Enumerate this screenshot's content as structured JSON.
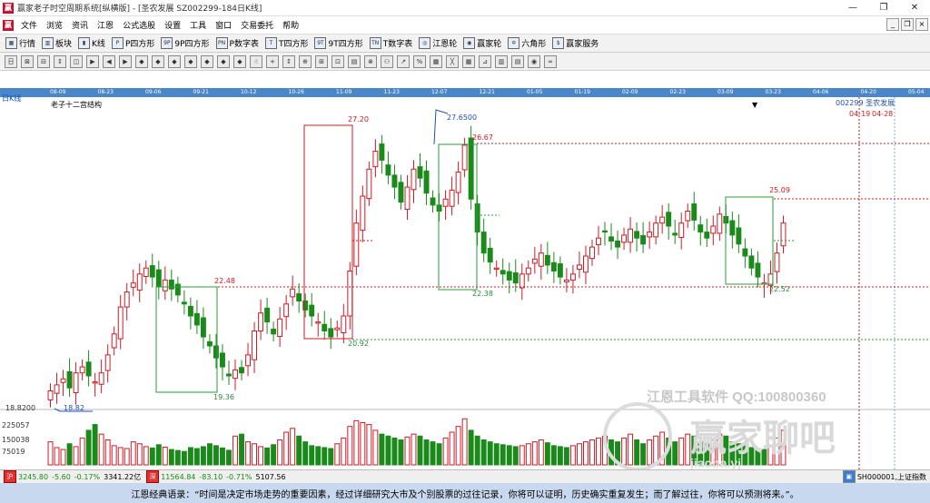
{
  "window": {
    "title": "赢家老子时空周期系统[纵横版] - [圣农发展  SZ002299-184日K线]",
    "app_icon": "赢"
  },
  "menu": [
    "文件",
    "浏览",
    "资讯",
    "江恩",
    "公式选股",
    "设置",
    "工具",
    "窗口",
    "交易委托",
    "帮助"
  ],
  "toolbar1": [
    "行情",
    "板块",
    "K线",
    "P四方形",
    "9P四方形",
    "P数字表",
    "T四方形",
    "9T四方形",
    "T数字表",
    "江恩轮",
    "赢家轮",
    "六角形",
    "赢家服务"
  ],
  "toolbar2_icons": [
    "日",
    "⊠",
    "⊟",
    "↕",
    "◫",
    "▶",
    "◀",
    "▶",
    "◆",
    "◆",
    "◆",
    "◆",
    "◆",
    "◆",
    "◆",
    "☝",
    "+",
    "↕",
    "⊕",
    "⊞",
    "⊡",
    "▤",
    "⊗",
    "⚇",
    "↗",
    "%",
    "▦",
    "╳",
    "▦",
    "⊿",
    "▥",
    "▤",
    "◉",
    "∞"
  ],
  "date_ticks": [
    "08-09",
    "08-23",
    "09-06",
    "09-21",
    "10-12",
    "10-26",
    "11-09",
    "11-23",
    "12-07",
    "12-21",
    "01-05",
    "01-19",
    "02-09",
    "02-23",
    "03-09",
    "03-23",
    "04-06",
    "04-20",
    "05-04"
  ],
  "chart": {
    "period_label": "日K线",
    "structure_label": "老子十二宫结构",
    "stock_label": "002299 圣农发展",
    "date_marks": [
      "04-19",
      "04-28"
    ],
    "price_labels": {
      "p1": "18.8200",
      "p1b": "18.82",
      "p2": "19.36",
      "p3": "22.48",
      "p4": "20.92",
      "p5": "27.20",
      "p6": "27.6500",
      "p7": "26.67",
      "p8": "22.38",
      "p9": "25.09",
      "p10": "22.52"
    },
    "vol_ticks": [
      "225057",
      "150038",
      "75019"
    ],
    "watermark1": "江恩工具软件  QQ:100800360",
    "watermark2": "赢家聊吧",
    "watermark3": "jiaoba.yj"
  },
  "chart_data": {
    "type": "candlestick",
    "title": "",
    "xlabel": "",
    "ylabel": "",
    "ylim": [
      18.5,
      28.5
    ],
    "series": [
      {
        "name": "",
        "values": [
          19.0,
          19.2,
          19.4,
          19.1,
          19.6,
          19.8,
          19.5,
          19.3,
          19.6,
          20.2,
          20.9,
          21.8,
          22.3,
          22.6,
          22.9,
          23.1,
          22.8,
          22.5,
          22.7,
          22.4,
          22.2,
          21.9,
          21.5,
          21.2,
          20.8,
          20.5,
          20.1,
          19.8,
          19.5,
          19.7,
          19.6,
          20.2,
          21.0,
          21.6,
          21.3,
          20.9,
          21.4,
          21.9,
          22.4,
          22.0,
          21.7,
          21.5,
          21.3,
          21.0,
          20.8,
          21.1,
          21.5,
          23.0,
          24.6,
          25.5,
          26.4,
          27.0,
          26.7,
          26.2,
          25.8,
          25.3,
          25.8,
          26.4,
          26.1,
          25.6,
          25.2,
          25.0,
          25.4,
          25.7,
          26.3,
          27.2,
          25.4,
          24.3,
          23.6,
          23.3,
          23.1,
          22.9,
          22.7,
          22.6,
          22.9,
          23.1,
          23.4,
          23.6,
          23.2,
          23.0,
          22.8,
          22.7,
          22.9,
          23.2,
          23.5,
          23.8,
          24.1,
          24.3,
          24.0,
          23.8,
          24.2,
          24.4,
          24.1,
          23.9,
          24.3,
          24.6,
          24.8,
          24.5,
          24.2,
          24.6,
          25.0,
          24.7,
          24.3,
          24.1,
          24.5,
          24.9,
          24.6,
          24.2,
          23.9,
          23.5,
          23.1,
          22.8,
          22.6,
          22.9,
          23.6,
          24.6
        ]
      }
    ],
    "volume": [
      120000,
      90000,
      80000,
      110000,
      95000,
      140000,
      180000,
      210000,
      160000,
      130000,
      100000,
      90000,
      85000,
      120000,
      110000,
      95000,
      88000,
      105000,
      92000,
      80000,
      75000,
      70000,
      90000,
      85000,
      95000,
      110000,
      100000,
      88000,
      76000,
      150000,
      160000,
      120000,
      110000,
      95000,
      88000,
      105000,
      130000,
      170000,
      190000,
      150000,
      120000,
      100000,
      95000,
      90000,
      85000,
      110000,
      140000,
      200000,
      230000,
      220000,
      210000,
      180000,
      160000,
      150000,
      140000,
      130000,
      145000,
      160000,
      150000,
      130000,
      120000,
      110000,
      140000,
      170000,
      200000,
      240000,
      180000,
      150000,
      130000,
      120000,
      110000,
      105000,
      100000,
      95000,
      100000,
      110000,
      120000,
      130000,
      115000,
      100000,
      95000,
      90000,
      100000,
      110000,
      120000,
      130000,
      140000,
      150000,
      130000,
      120000,
      140000,
      160000,
      130000,
      110000,
      130000,
      150000,
      170000,
      140000,
      120000,
      140000,
      160000,
      150000,
      120000,
      110000,
      130000,
      160000,
      150000,
      120000,
      110000,
      100000,
      90000,
      85000,
      80000,
      100000,
      140000,
      180000
    ],
    "vol_ylim": [
      0,
      260000
    ]
  },
  "status": {
    "sh_index": "3245.80",
    "sh_chg": "-5.60",
    "sh_pct": "-0.17%",
    "sh_amt": "3341.22亿",
    "sz_index": "11564.84",
    "sz_chg": "-83.10",
    "sz_pct": "-0.71%",
    "sz_amt": "5107.56",
    "right": "SH000001,上证指数"
  },
  "quote": "江恩经典语录：“时间是决定市场走势的重要因素，经过详细研究大市及个别股票的过往记录，你将可以证明，历史确实重复发生；而了解过往，你将可以预测将来。”。",
  "colors": {
    "up": "#d01a26",
    "down": "#1a8a1a",
    "box_red": "#d01a26",
    "box_green": "#2a9a3a",
    "datebar": "#4a86c8",
    "quote_bg": "#c8d8ee"
  }
}
